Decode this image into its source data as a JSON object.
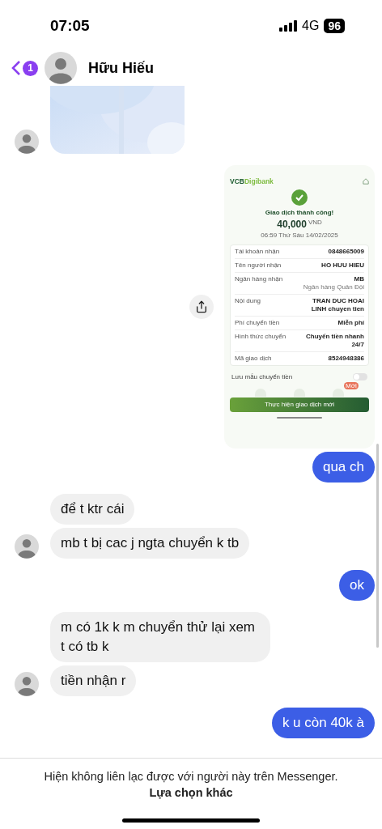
{
  "status_bar": {
    "time": "07:05",
    "network": "4G",
    "battery": "96"
  },
  "header": {
    "unread_count": "1",
    "contact_name": "Hữu Hiếu"
  },
  "messages": [
    {
      "kind": "picture",
      "outgoing": false,
      "show_avatar": true
    },
    {
      "kind": "screenshot",
      "outgoing": true,
      "show_avatar": false,
      "screenshot": {
        "logo_main": "VCB",
        "logo_sub": "Digibank",
        "status": "Giao dịch thành công!",
        "amount": "40,000",
        "currency": "VND",
        "datetime": "06:59 Thứ Sáu 14/02/2025",
        "rows": [
          {
            "label": "Tài khoản nhận",
            "value": "0848665009"
          },
          {
            "label": "Tên người nhận",
            "value": "HO HUU HIEU"
          },
          {
            "label": "Ngân hàng nhận",
            "value": "MB",
            "note": "Ngân hàng Quân Đội"
          },
          {
            "label": "Nội dung",
            "value": "TRAN DUC HOAI LINH chuyen tien"
          },
          {
            "label": "Phí chuyển tiền",
            "value": "Miễn phí"
          },
          {
            "label": "Hình thức chuyển",
            "value": "Chuyển tiền nhanh 24/7"
          },
          {
            "label": "Mã giao dịch",
            "value": "8524948386"
          }
        ],
        "save_template": {
          "label": "Lưu mẫu chuyển tiền",
          "on": false
        },
        "new_badge": "Mới",
        "button": "Thực hiện giao dịch mới"
      }
    },
    {
      "kind": "text",
      "outgoing": true,
      "show_avatar": false,
      "text": "qua ch"
    },
    {
      "kind": "text",
      "outgoing": false,
      "show_avatar": false,
      "text": "để t ktr cái"
    },
    {
      "kind": "text",
      "outgoing": false,
      "show_avatar": true,
      "text": "mb t bị cac j ngta chuyển k tb"
    },
    {
      "kind": "text",
      "outgoing": true,
      "show_avatar": false,
      "text": "ok"
    },
    {
      "kind": "text",
      "outgoing": false,
      "show_avatar": false,
      "text": "m có 1k k m chuyển thử lại xem t có tb k"
    },
    {
      "kind": "text",
      "outgoing": false,
      "show_avatar": true,
      "text": "tiền nhận r"
    },
    {
      "kind": "text",
      "outgoing": true,
      "show_avatar": false,
      "text": "k u còn 40k à"
    }
  ],
  "footer": {
    "notice": "Hiện không liên lạc được với người này trên Messenger.",
    "link": "Lựa chọn khác"
  }
}
